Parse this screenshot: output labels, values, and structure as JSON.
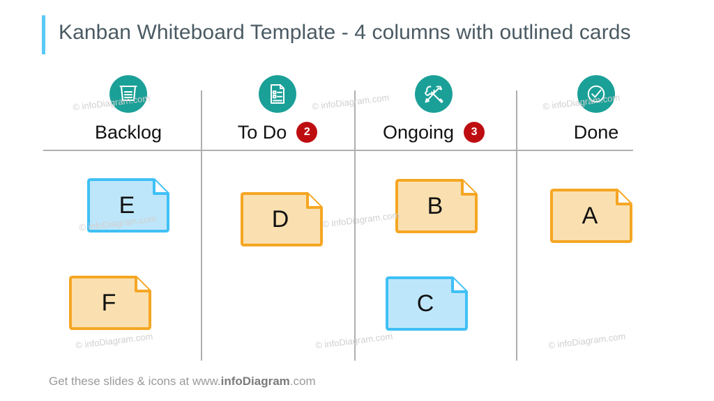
{
  "title": "Kanban Whiteboard Template - 4 columns with outlined cards",
  "colors": {
    "title_accent": "#5BC8F5",
    "title_text": "#4A5A63",
    "icon_circle_teal": "#1BA098",
    "badge_red": "#BE0D11",
    "divider_gray": "#AFAFAF",
    "card_blue_fill": "#BEE6FA",
    "card_blue_border": "#3FC0F5",
    "card_orange_fill": "#FAE0B0",
    "card_orange_border": "#F5A623",
    "watermark_gray": "#CFCFCF",
    "footer_gray": "#9A9A9A"
  },
  "columns": [
    {
      "label": "Backlog",
      "icon": "inbox-tray-icon",
      "badge": null
    },
    {
      "label": "To Do",
      "icon": "checklist-document-icon",
      "badge": "2"
    },
    {
      "label": "Ongoing",
      "icon": "wrench-hammer-tools-icon",
      "badge": "3"
    },
    {
      "label": "Done",
      "icon": "check-circle-icon",
      "badge": null
    }
  ],
  "cards": [
    {
      "letter": "E",
      "color": "blue",
      "column": "Backlog"
    },
    {
      "letter": "F",
      "color": "orange",
      "column": "Backlog"
    },
    {
      "letter": "D",
      "color": "orange",
      "column": "To Do"
    },
    {
      "letter": "B",
      "color": "orange",
      "column": "Ongoing"
    },
    {
      "letter": "C",
      "color": "blue",
      "column": "Ongoing"
    },
    {
      "letter": "A",
      "color": "orange",
      "column": "Done"
    }
  ],
  "watermarks": [
    "© infoDiagram.com",
    "© infoDiagram.com",
    "© infoDiagram.com",
    "© infoDiagram.com",
    "© infoDiagram.com",
    "© infoDiagram.com",
    "© infoDiagram.com"
  ],
  "footer": {
    "prefix": "Get these slides & icons at www.",
    "brand": "infoDiagram",
    "suffix": ".com"
  }
}
